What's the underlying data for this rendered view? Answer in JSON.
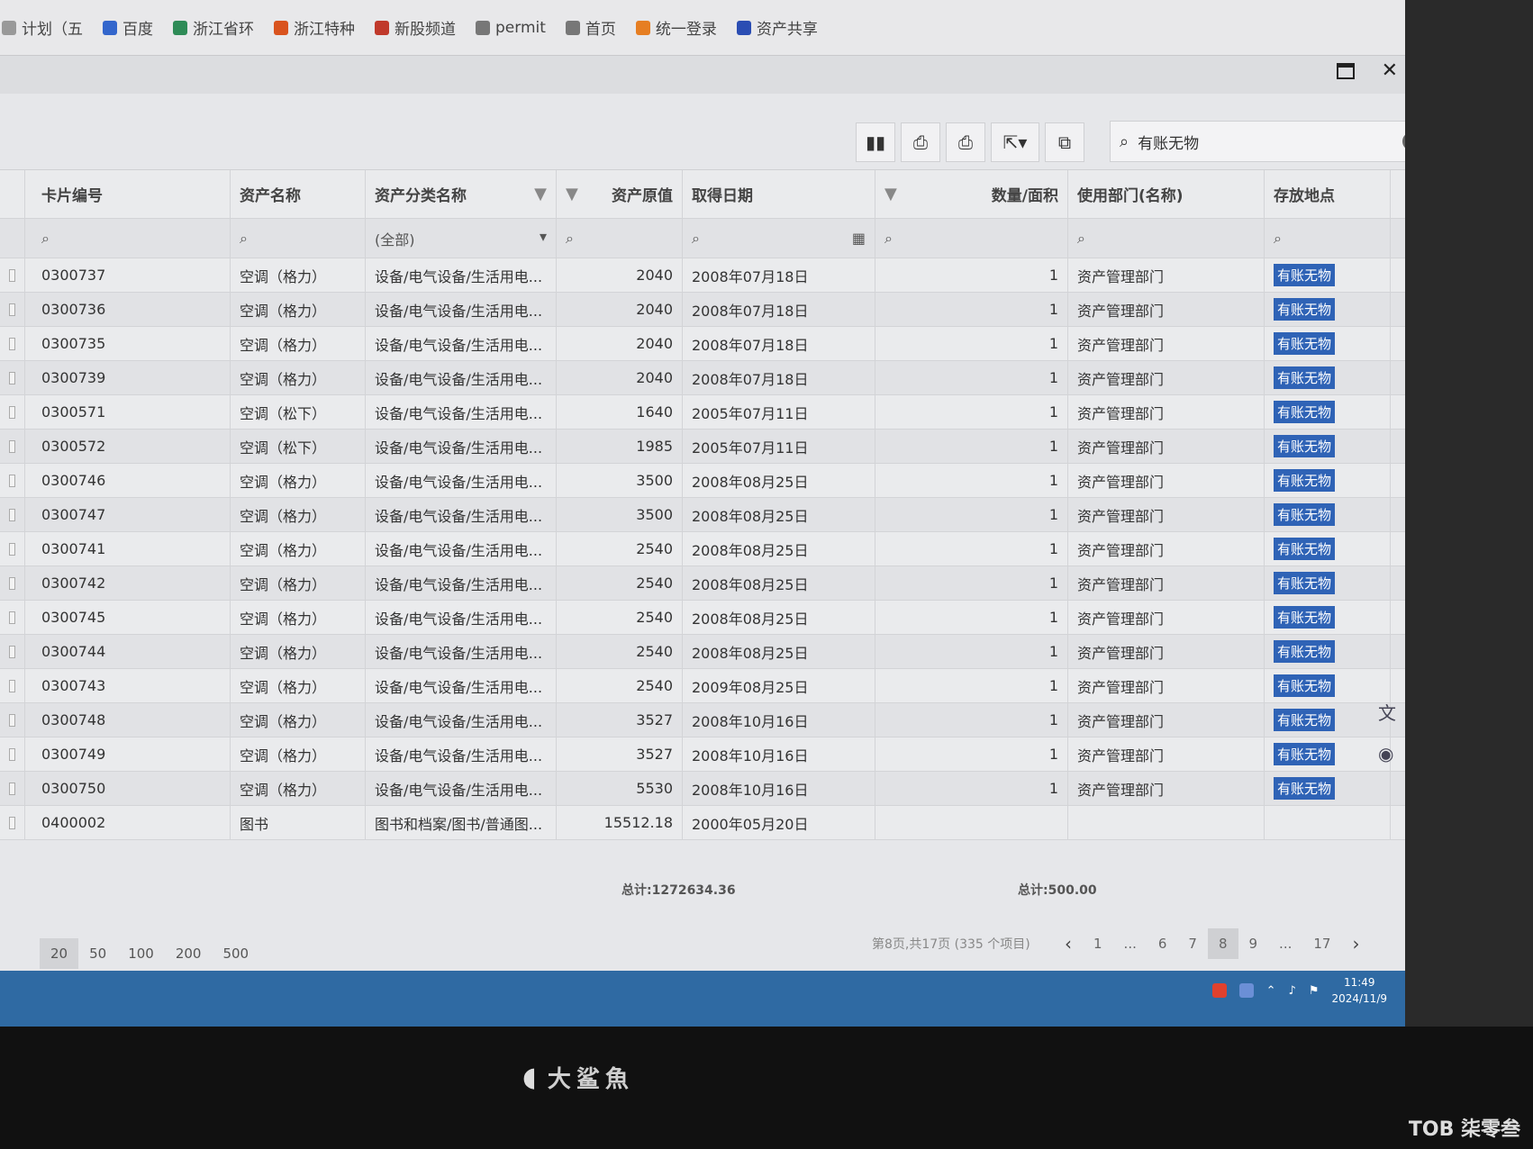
{
  "bookmarks": [
    {
      "label": "计划（五",
      "color": "#999"
    },
    {
      "label": "百度",
      "color": "#3366cc"
    },
    {
      "label": "浙江省环",
      "color": "#2e8b57"
    },
    {
      "label": "浙江特种",
      "color": "#d9531e"
    },
    {
      "label": "新股频道",
      "color": "#c0392b"
    },
    {
      "label": "permit",
      "color": "#777"
    },
    {
      "label": "首页",
      "color": "#777"
    },
    {
      "label": "统一登录",
      "color": "#e67e22"
    },
    {
      "label": "资产共享",
      "color": "#2a4db3"
    }
  ],
  "toolbar": {
    "chart_icon": "▮▮",
    "print_icon": "⎙",
    "print2_icon": "⎙",
    "export_icon": "⇱▾",
    "copy_icon": "⧉"
  },
  "search": {
    "value": "有账无物"
  },
  "columns": {
    "card_no": "卡片编号",
    "asset_name": "资产名称",
    "category": "资产分类名称",
    "orig_value": "资产原值",
    "acq_date": "取得日期",
    "quantity": "数量/面积",
    "dept": "使用部门(名称)",
    "location": "存放地点"
  },
  "filter": {
    "category_select": "(全部)"
  },
  "rows": [
    {
      "card": "0300737",
      "name": "空调（格力）",
      "cat": "设备/电气设备/生活用电...",
      "value": "2040",
      "date": "2008年07月18日",
      "qty": "1",
      "dept": "资产管理部门",
      "loc": "有账无物"
    },
    {
      "card": "0300736",
      "name": "空调（格力）",
      "cat": "设备/电气设备/生活用电...",
      "value": "2040",
      "date": "2008年07月18日",
      "qty": "1",
      "dept": "资产管理部门",
      "loc": "有账无物"
    },
    {
      "card": "0300735",
      "name": "空调（格力）",
      "cat": "设备/电气设备/生活用电...",
      "value": "2040",
      "date": "2008年07月18日",
      "qty": "1",
      "dept": "资产管理部门",
      "loc": "有账无物"
    },
    {
      "card": "0300739",
      "name": "空调（格力）",
      "cat": "设备/电气设备/生活用电...",
      "value": "2040",
      "date": "2008年07月18日",
      "qty": "1",
      "dept": "资产管理部门",
      "loc": "有账无物"
    },
    {
      "card": "0300571",
      "name": "空调（松下）",
      "cat": "设备/电气设备/生活用电...",
      "value": "1640",
      "date": "2005年07月11日",
      "qty": "1",
      "dept": "资产管理部门",
      "loc": "有账无物"
    },
    {
      "card": "0300572",
      "name": "空调（松下）",
      "cat": "设备/电气设备/生活用电...",
      "value": "1985",
      "date": "2005年07月11日",
      "qty": "1",
      "dept": "资产管理部门",
      "loc": "有账无物"
    },
    {
      "card": "0300746",
      "name": "空调（格力）",
      "cat": "设备/电气设备/生活用电...",
      "value": "3500",
      "date": "2008年08月25日",
      "qty": "1",
      "dept": "资产管理部门",
      "loc": "有账无物"
    },
    {
      "card": "0300747",
      "name": "空调（格力）",
      "cat": "设备/电气设备/生活用电...",
      "value": "3500",
      "date": "2008年08月25日",
      "qty": "1",
      "dept": "资产管理部门",
      "loc": "有账无物"
    },
    {
      "card": "0300741",
      "name": "空调（格力）",
      "cat": "设备/电气设备/生活用电...",
      "value": "2540",
      "date": "2008年08月25日",
      "qty": "1",
      "dept": "资产管理部门",
      "loc": "有账无物"
    },
    {
      "card": "0300742",
      "name": "空调（格力）",
      "cat": "设备/电气设备/生活用电...",
      "value": "2540",
      "date": "2008年08月25日",
      "qty": "1",
      "dept": "资产管理部门",
      "loc": "有账无物"
    },
    {
      "card": "0300745",
      "name": "空调（格力）",
      "cat": "设备/电气设备/生活用电...",
      "value": "2540",
      "date": "2008年08月25日",
      "qty": "1",
      "dept": "资产管理部门",
      "loc": "有账无物"
    },
    {
      "card": "0300744",
      "name": "空调（格力）",
      "cat": "设备/电气设备/生活用电...",
      "value": "2540",
      "date": "2008年08月25日",
      "qty": "1",
      "dept": "资产管理部门",
      "loc": "有账无物"
    },
    {
      "card": "0300743",
      "name": "空调（格力）",
      "cat": "设备/电气设备/生活用电...",
      "value": "2540",
      "date": "2009年08月25日",
      "qty": "1",
      "dept": "资产管理部门",
      "loc": "有账无物"
    },
    {
      "card": "0300748",
      "name": "空调（格力）",
      "cat": "设备/电气设备/生活用电...",
      "value": "3527",
      "date": "2008年10月16日",
      "qty": "1",
      "dept": "资产管理部门",
      "loc": "有账无物"
    },
    {
      "card": "0300749",
      "name": "空调（格力）",
      "cat": "设备/电气设备/生活用电...",
      "value": "3527",
      "date": "2008年10月16日",
      "qty": "1",
      "dept": "资产管理部门",
      "loc": "有账无物"
    },
    {
      "card": "0300750",
      "name": "空调（格力）",
      "cat": "设备/电气设备/生活用电...",
      "value": "5530",
      "date": "2008年10月16日",
      "qty": "1",
      "dept": "资产管理部门",
      "loc": "有账无物"
    },
    {
      "card": "0400002",
      "name": "图书",
      "cat": "图书和档案/图书/普通图...",
      "value": "15512.18",
      "date": "2000年05月20日",
      "qty": "",
      "dept": "",
      "loc": ""
    }
  ],
  "totals": {
    "orig_value": "总计:1272634.36",
    "quantity": "总计:500.00"
  },
  "pager": {
    "sizes": [
      "20",
      "50",
      "100",
      "200",
      "500"
    ],
    "active_size": "20",
    "info": "第8页,共17页 (335 个项目)",
    "pages": [
      "1",
      "...",
      "6",
      "7",
      "8",
      "9",
      "...",
      "17"
    ],
    "current": "8"
  },
  "tray": {
    "time": "11:49",
    "date": "2024/11/9"
  },
  "monitor": {
    "brand": "大鲨魚"
  },
  "watermark": "TOB 柒零叁"
}
